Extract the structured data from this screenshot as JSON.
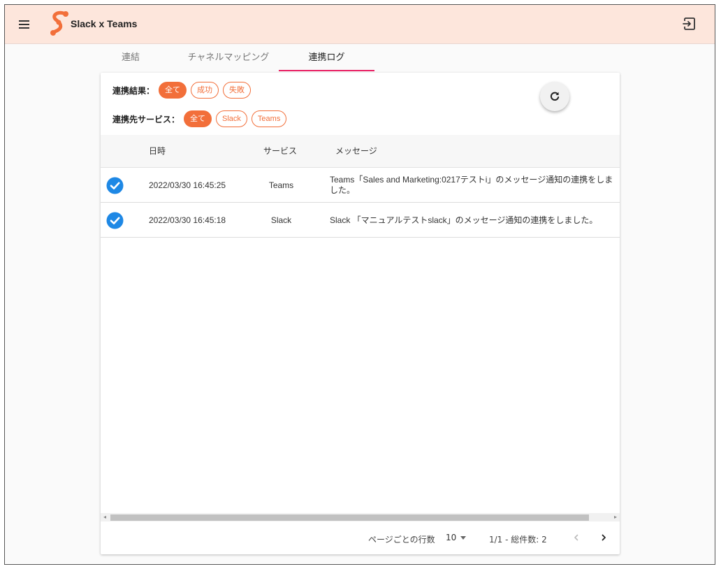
{
  "header": {
    "app_title": "Slack x Teams",
    "brand_color": "#f26f3a",
    "bar_color": "#fde6dc"
  },
  "tabs": [
    {
      "label": "連結",
      "active": false
    },
    {
      "label": "チャネルマッピング",
      "active": false
    },
    {
      "label": "連携ログ",
      "active": true
    }
  ],
  "filters": {
    "result": {
      "label": "連携結果：",
      "options": [
        {
          "label": "全て",
          "selected": true
        },
        {
          "label": "成功",
          "selected": false
        },
        {
          "label": "失敗",
          "selected": false
        }
      ]
    },
    "service": {
      "label": "連携先サービス：",
      "options": [
        {
          "label": "全て",
          "selected": true
        },
        {
          "label": "Slack",
          "selected": false
        },
        {
          "label": "Teams",
          "selected": false
        }
      ]
    }
  },
  "table": {
    "columns": {
      "time": "日時",
      "service": "サービス",
      "message": "メッセージ"
    },
    "rows": [
      {
        "status": "success",
        "time": "2022/03/30 16:45:25",
        "service": "Teams",
        "message": "Teams「Sales and Marketing:0217テストi」のメッセージ通知の連携をしました。"
      },
      {
        "status": "success",
        "time": "2022/03/30 16:45:18",
        "service": "Slack",
        "message": "Slack 「マニュアルテストslack」のメッセージ通知の連携をしました。"
      }
    ]
  },
  "pagination": {
    "rows_per_page_label": "ページごとの行数",
    "rows_per_page": "10",
    "range_text": "1/1 - 総件数: 2"
  },
  "icons": {
    "menu": "menu-icon",
    "logout": "logout-icon",
    "refresh": "refresh-icon",
    "check": "check-circle-icon",
    "prev": "chevron-left-icon",
    "next": "chevron-right-icon"
  },
  "check_color": "#1e88e5"
}
